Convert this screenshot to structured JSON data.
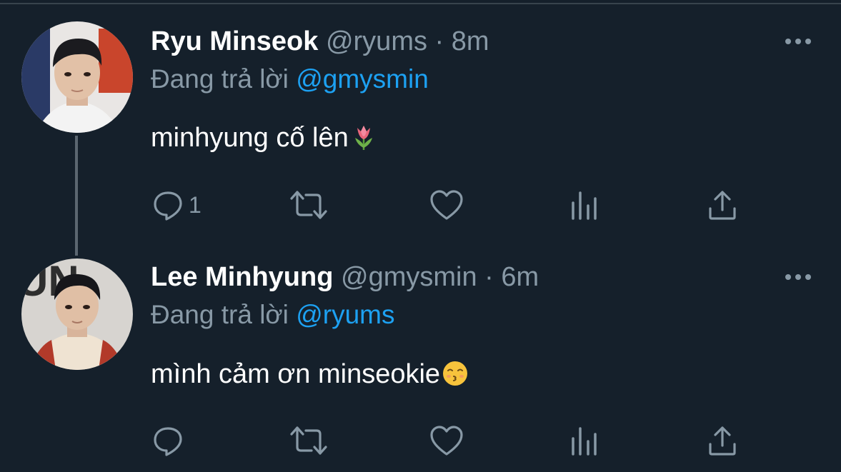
{
  "colors": {
    "background": "#15202b",
    "text_primary": "#ffffff",
    "text_secondary": "#8899a6",
    "accent": "#1da1f2",
    "thread_line": "#5b6670"
  },
  "tweets": [
    {
      "name": "Ryu Minseok",
      "handle": "@ryums",
      "separator": "·",
      "time": "8m",
      "reply_prefix": "Đang trả lời",
      "reply_to": "@gmysmin",
      "text": "minhyung cố lên",
      "emoji": "tulip",
      "actions": {
        "reply_icon": "reply-icon",
        "reply_count": "1",
        "retweet_icon": "retweet-icon",
        "like_icon": "heart-icon",
        "analytics_icon": "analytics-icon",
        "share_icon": "share-icon"
      },
      "more_icon": "more-icon"
    },
    {
      "name": "Lee Minhyung",
      "handle": "@gmysmin",
      "separator": "·",
      "time": "6m",
      "reply_prefix": "Đang trả lời",
      "reply_to": "@ryums",
      "text": "mình cảm ơn minseokie",
      "emoji": "kissing-smiling-eyes",
      "actions": {
        "reply_icon": "reply-icon",
        "reply_count": "",
        "retweet_icon": "retweet-icon",
        "like_icon": "heart-icon",
        "analytics_icon": "analytics-icon",
        "share_icon": "share-icon"
      },
      "more_icon": "more-icon"
    }
  ]
}
